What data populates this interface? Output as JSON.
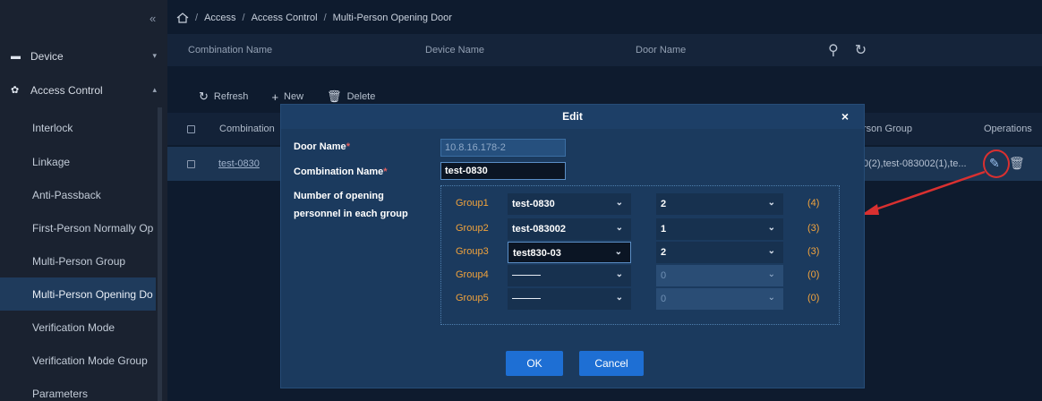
{
  "sidebar": {
    "collapse_icon": "double-chevron-left-icon",
    "groups": [
      {
        "label": "Device",
        "icon": "device-icon",
        "expanded": false
      },
      {
        "label": "Access Control",
        "icon": "gear-icon",
        "expanded": true
      }
    ],
    "items": [
      {
        "label": "Interlock"
      },
      {
        "label": "Linkage"
      },
      {
        "label": "Anti-Passback"
      },
      {
        "label": "First-Person Normally Op"
      },
      {
        "label": "Multi-Person Group"
      },
      {
        "label": "Multi-Person Opening Do"
      },
      {
        "label": "Verification Mode"
      },
      {
        "label": "Verification Mode Group"
      },
      {
        "label": "Parameters"
      }
    ],
    "active_item": "Multi-Person Opening Do"
  },
  "breadcrumb": [
    "Access",
    "Access Control",
    "Multi-Person Opening Door"
  ],
  "search": {
    "combination_name": "Combination Name",
    "device_name": "Device Name",
    "door_name": "Door Name"
  },
  "toolbar": {
    "refresh": "Refresh",
    "new": "New",
    "delete": "Delete"
  },
  "table": {
    "headers": {
      "combination": "Combination",
      "person_group": "rson Group",
      "operations": "Operations"
    },
    "rows": [
      {
        "combination": "test-0830",
        "person_group": "0(2),test-083002(1),te..."
      }
    ]
  },
  "dialog": {
    "title": "Edit",
    "door_name_label": "Door Name",
    "door_name_value": "10.8.16.178-2",
    "combination_name_label": "Combination Name",
    "combination_name_value": "test-0830",
    "groups_label_line1": "Number of opening",
    "groups_label_line2": "personnel in each group",
    "groups": [
      {
        "label": "Group1",
        "group": "test-0830",
        "count": "2",
        "available": "(4)",
        "disabled": false
      },
      {
        "label": "Group2",
        "group": "test-083002",
        "count": "1",
        "available": "(3)",
        "disabled": false
      },
      {
        "label": "Group3",
        "group": "test830-03",
        "count": "2",
        "available": "(3)",
        "disabled": false
      },
      {
        "label": "Group4",
        "group": "",
        "count": "0",
        "available": "(0)",
        "disabled": true
      },
      {
        "label": "Group5",
        "group": "",
        "count": "0",
        "available": "(0)",
        "disabled": true
      }
    ],
    "ok": "OK",
    "cancel": "Cancel",
    "close": "×"
  },
  "colors": {
    "accent": "#1e6fd4",
    "highlight": "#f0a23c",
    "annotation": "#d93030"
  }
}
